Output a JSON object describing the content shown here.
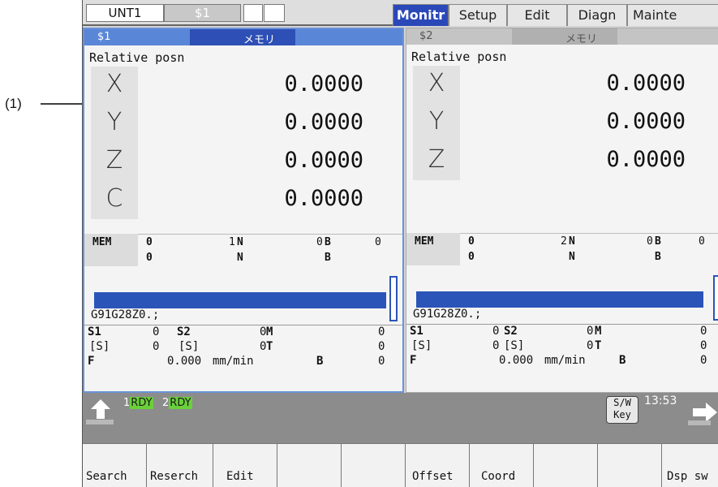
{
  "callout": {
    "label": "(1)"
  },
  "topbar": {
    "unit": "UNT1",
    "system": "$1",
    "tabs": [
      "Monitr",
      "Setup",
      "Edit",
      "Diagn",
      "Mainte"
    ],
    "active_tab": "Monitr"
  },
  "panels": [
    {
      "header": {
        "system": "$1",
        "mode": "メモリ"
      },
      "title": "Relative posn",
      "axes": [
        {
          "name": "X",
          "value": "0.0000"
        },
        {
          "name": "Y",
          "value": "0.0000"
        },
        {
          "name": "Z",
          "value": "0.0000"
        },
        {
          "name": "C",
          "value": "0.0000"
        }
      ],
      "status": {
        "mode": "MEM",
        "o1": "0",
        "o2": "0",
        "n1": "1",
        "b1": "0",
        "b_val": "0",
        "n_label": "N",
        "b_label": "B"
      },
      "program_line": "G91G28Z0.;",
      "grid": {
        "s1": "S1",
        "s1_val": "0",
        "s2": "S2",
        "s2_val": "0",
        "m": "M",
        "m_val": "0",
        "s_bracket1": "[S]",
        "s_bracket1_val": "0",
        "s_bracket2": "[S]",
        "s_bracket2_val": "0",
        "t": "T",
        "t_val": "0",
        "f": "F",
        "f_val": "0.000",
        "f_unit": "mm/min",
        "b": "B",
        "b_val": "0"
      }
    },
    {
      "header": {
        "system": "$2",
        "mode": "メモリ"
      },
      "title": "Relative posn",
      "axes": [
        {
          "name": "X",
          "value": "0.0000"
        },
        {
          "name": "Y",
          "value": "0.0000"
        },
        {
          "name": "Z",
          "value": "0.0000"
        }
      ],
      "status": {
        "mode": "MEM",
        "o1": "0",
        "o2": "0",
        "n1": "2",
        "b1": "0",
        "b_val": "0",
        "n_label": "N",
        "b_label": "B"
      },
      "program_line": "G91G28Z0.;",
      "grid": {
        "s1": "S1",
        "s1_val": "0",
        "s2": "S2",
        "s2_val": "0",
        "m": "M",
        "m_val": "0",
        "s_bracket1": "[S]",
        "s_bracket1_val": "0",
        "s_bracket2": "[S]",
        "s_bracket2_val": "0",
        "t": "T",
        "t_val": "0",
        "f": "F",
        "f_val": "0.000",
        "f_unit": "mm/min",
        "b": "B",
        "b_val": "0"
      }
    }
  ],
  "status_bar": {
    "rdy1_num": "1",
    "rdy1": "RDY",
    "rdy2_num": "2",
    "rdy2": "RDY",
    "swkey_line1": "S/W",
    "swkey_line2": "Key",
    "clock": "13:53"
  },
  "menu": [
    "Search",
    "Reserch",
    "Edit",
    "",
    "",
    "Offset",
    "Coord",
    "",
    "",
    "Dsp sw"
  ],
  "colors": {
    "accent": "#2b48b8",
    "panel_header": "#5a86d8",
    "rdy": "#6ad03a"
  }
}
